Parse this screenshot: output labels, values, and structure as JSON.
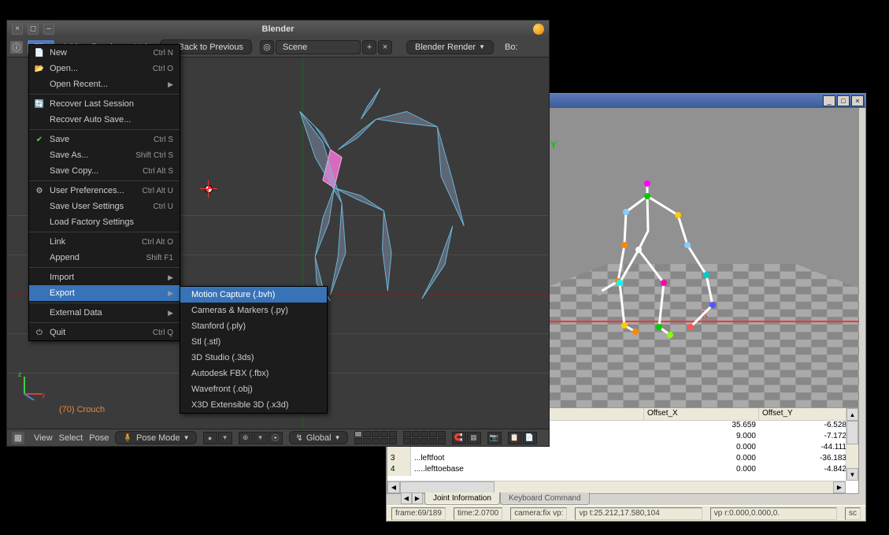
{
  "blender": {
    "title": "Blender",
    "menubar": {
      "file": "File",
      "add": "Add",
      "render": "Render",
      "help": "Help",
      "back_btn": "Back to Previous",
      "scene_label": "Scene",
      "renderer": "Blender Render",
      "box_label": "Bo:"
    },
    "file_menu": [
      {
        "icon": "📄",
        "label": "New",
        "shortcut": "Ctrl N"
      },
      {
        "icon": "📂",
        "label": "Open...",
        "shortcut": "Ctrl O"
      },
      {
        "icon": "",
        "label": "Open Recent...",
        "submenu": true
      },
      {
        "sep": true
      },
      {
        "icon": "🔄",
        "label": "Recover Last Session"
      },
      {
        "icon": "",
        "label": "Recover Auto Save..."
      },
      {
        "sep": true
      },
      {
        "icon": "✔",
        "label": "Save",
        "shortcut": "Ctrl S",
        "tint": "#6c6"
      },
      {
        "icon": "",
        "label": "Save As...",
        "shortcut": "Shift Ctrl S"
      },
      {
        "icon": "",
        "label": "Save Copy...",
        "shortcut": "Ctrl Alt S"
      },
      {
        "sep": true
      },
      {
        "icon": "⚙",
        "label": "User Preferences...",
        "shortcut": "Ctrl Alt U"
      },
      {
        "icon": "",
        "label": "Save User Settings",
        "shortcut": "Ctrl U"
      },
      {
        "icon": "",
        "label": "Load Factory Settings"
      },
      {
        "sep": true
      },
      {
        "icon": "",
        "label": "Link",
        "shortcut": "Ctrl Alt O"
      },
      {
        "icon": "",
        "label": "Append",
        "shortcut": "Shift F1"
      },
      {
        "sep": true
      },
      {
        "icon": "",
        "label": "Import",
        "submenu": true
      },
      {
        "icon": "",
        "label": "Export",
        "submenu": true,
        "highlighted": true
      },
      {
        "sep": true
      },
      {
        "icon": "",
        "label": "External Data",
        "submenu": true
      },
      {
        "sep": true
      },
      {
        "icon": "⏻",
        "label": "Quit",
        "shortcut": "Ctrl Q"
      }
    ],
    "export_menu": [
      {
        "label": "Motion Capture (.bvh)",
        "highlighted": true
      },
      {
        "label": "Cameras & Markers (.py)"
      },
      {
        "label": "Stanford (.ply)"
      },
      {
        "label": "Stl (.stl)"
      },
      {
        "label": "3D Studio (.3ds)"
      },
      {
        "label": "Autodesk FBX (.fbx)"
      },
      {
        "label": "Wavefront (.obj)"
      },
      {
        "label": "X3D Extensible 3D (.x3d)"
      }
    ],
    "viewport": {
      "armature": "(70) Crouch"
    },
    "bottombar": {
      "view": "View",
      "select": "Select",
      "pose": "Pose",
      "mode": "Pose Mode",
      "global": "Global"
    }
  },
  "viewer": {
    "axis_y_label": "Y",
    "axis_x_label": "X",
    "table": {
      "headers": {
        "offset_x": "Offset_X",
        "offset_y": "Offset_Y"
      },
      "rows": [
        {
          "idx": "",
          "name": "",
          "ox": "35.659",
          "oy": "-6.528"
        },
        {
          "idx": "",
          "name": "",
          "ox": "9.000",
          "oy": "-7.172"
        },
        {
          "idx": "",
          "name": "",
          "ox": "0.000",
          "oy": "-44.111"
        },
        {
          "idx": "3",
          "name": "...leftfoot",
          "ox": "0.000",
          "oy": "-36.183"
        },
        {
          "idx": "4",
          "name": ".....lefttoebase",
          "ox": "0.000",
          "oy": "-4.842"
        }
      ]
    },
    "tabs": {
      "joint": "Joint Information",
      "keyboard": "Keyboard Command"
    },
    "status": {
      "frame": "frame:69/189",
      "time": "time:2.0700",
      "camera": "camera:fix",
      "vp0": "vp:",
      "vp1": "vp t:25.212,17.580,104",
      "vp2": "vp r:0.000,0.000,0.",
      "sc": "sc"
    }
  }
}
